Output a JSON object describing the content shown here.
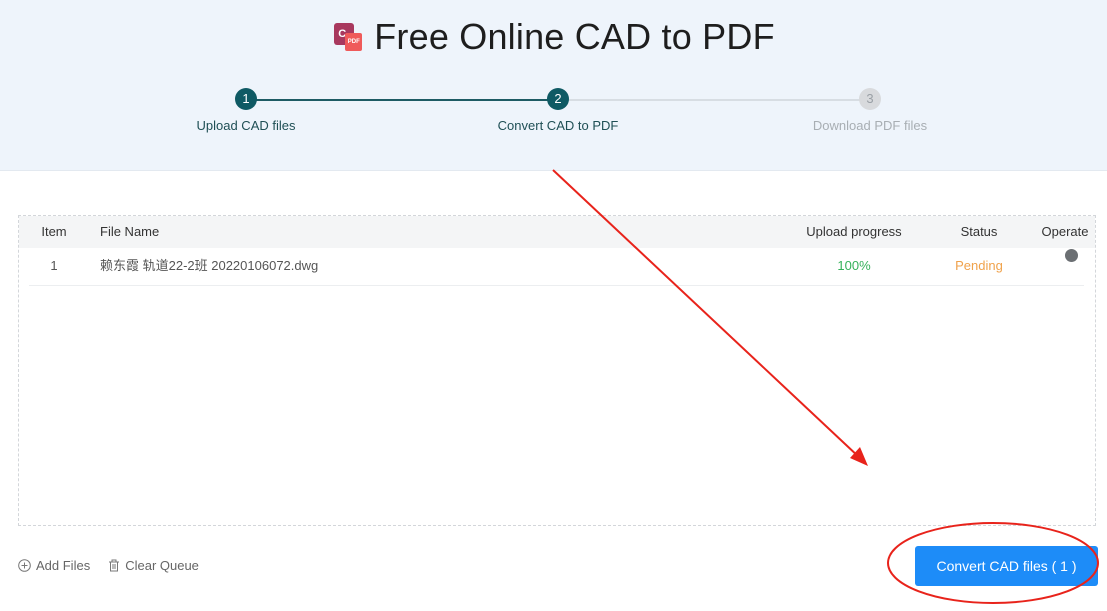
{
  "header": {
    "title": "Free Online CAD to PDF",
    "logo_icon": "cad-to-pdf-logo-icon",
    "logo_c": "C",
    "logo_pdf": "PDF"
  },
  "steps": [
    {
      "number": "1",
      "label": "Upload CAD files",
      "state": "done"
    },
    {
      "number": "2",
      "label": "Convert CAD to PDF",
      "state": "active"
    },
    {
      "number": "3",
      "label": "Download PDF files",
      "state": "inactive"
    }
  ],
  "table": {
    "columns": {
      "item": "Item",
      "file_name": "File Name",
      "upload_progress": "Upload progress",
      "status": "Status",
      "operate": "Operate"
    },
    "rows": [
      {
        "item": "1",
        "file_name": "赖东霞 轨道22-2班 20220106072.dwg",
        "upload_progress": "100%",
        "status": "Pending",
        "operate_icon": "remove-circle-icon"
      }
    ]
  },
  "actions": {
    "add_files": "Add Files",
    "add_files_icon": "plus-circle-icon",
    "clear_queue": "Clear Queue",
    "clear_queue_icon": "trash-icon"
  },
  "convert_button": {
    "label": "Convert CAD files ( 1 )"
  },
  "colors": {
    "header_bg": "#eef4fb",
    "step_active": "#0f5a64",
    "progress_green": "#35b15a",
    "status_pending": "#f0a24b",
    "primary_button": "#1d8cf8",
    "annotation_red": "#e8231b"
  }
}
